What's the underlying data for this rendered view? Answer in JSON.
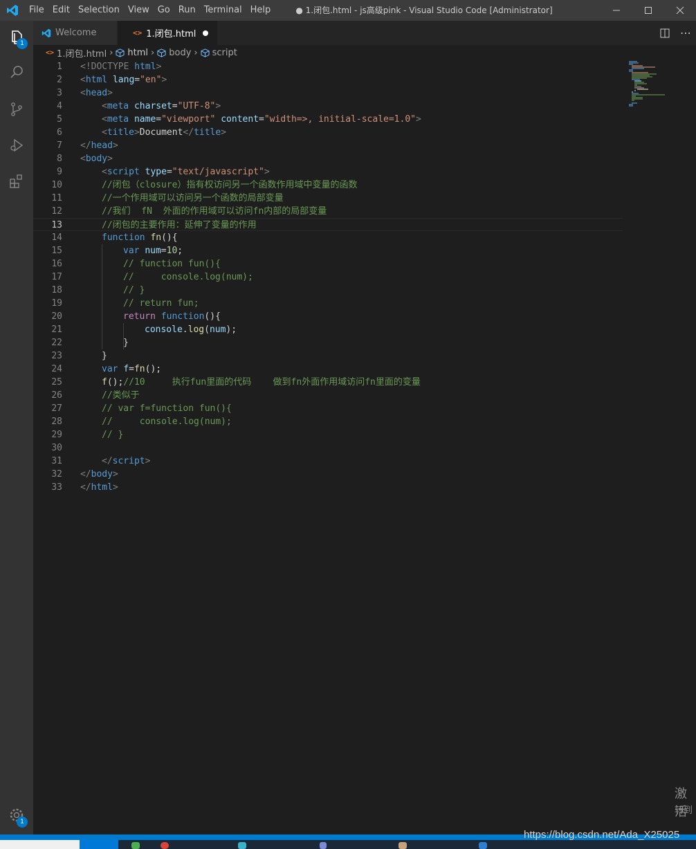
{
  "titlebar": {
    "menu": [
      "File",
      "Edit",
      "Selection",
      "View",
      "Go",
      "Run",
      "Terminal",
      "Help"
    ],
    "title": "● 1.闭包.html - js高级pink - Visual Studio Code [Administrator]"
  },
  "activitybar": {
    "explorer_badge": "1",
    "manage_badge": "1"
  },
  "tabs": [
    {
      "label": "Welcome"
    },
    {
      "label": "1.闭包.html"
    }
  ],
  "breadcrumb": [
    "1.闭包.html",
    "html",
    "body",
    "script"
  ],
  "editor": {
    "line_numbers": [
      "1",
      "2",
      "3",
      "4",
      "5",
      "6",
      "7",
      "8",
      "9",
      "10",
      "11",
      "12",
      "13",
      "14",
      "15",
      "16",
      "17",
      "18",
      "19",
      "20",
      "21",
      "22",
      "23",
      "24",
      "25",
      "26",
      "27",
      "28",
      "29",
      "30",
      "31",
      "32",
      "33"
    ],
    "l1": {
      "a": "<!DOCTYPE ",
      "b": "html",
      "c": ">"
    },
    "l2": {
      "a": "<",
      "b": "html",
      "c": " lang",
      "d": "=",
      "e": "\"en\"",
      "f": ">"
    },
    "l3": {
      "a": "<",
      "b": "head",
      "c": ">"
    },
    "l4": {
      "a": "<",
      "b": "meta",
      "c": " charset",
      "d": "=",
      "e": "\"UTF-8\"",
      "f": ">"
    },
    "l5": {
      "a": "<",
      "b": "meta",
      "c": " name",
      "d": "=",
      "e": "\"viewport\"",
      "f": " content",
      "g": "=",
      "h": "\"width=>, initial-scale=1.0\"",
      "i": ">"
    },
    "l6": {
      "a": "<",
      "b": "title",
      "c": ">",
      "d": "Document",
      "e": "</",
      "f": "title",
      "g": ">"
    },
    "l7": {
      "a": "</",
      "b": "head",
      "c": ">"
    },
    "l8": {
      "a": "<",
      "b": "body",
      "c": ">"
    },
    "l9": {
      "a": "<",
      "b": "script",
      "c": " type",
      "d": "=",
      "e": "\"text/javascript\"",
      "f": ">"
    },
    "l10": "//闭包（closure）指有权访问另一个函数作用域中变量的函数",
    "l11": "//一个作用域可以访问另一个函数的局部变量",
    "l12": "//我们  fN  外面的作用域可以访问fn内部的局部变量",
    "l13": "//闭包的主要作用：延伸了变量的作用",
    "l14": {
      "a": "function",
      "b": " ",
      "c": "fn",
      "d": "(){"
    },
    "l15": {
      "a": "var",
      "b": " ",
      "c": "num",
      "d": "=",
      "e": "10",
      "f": ";"
    },
    "l16": "// function fun(){",
    "l17": "//     console.log(num);",
    "l18": "// }",
    "l19": "// return fun;",
    "l20": {
      "a": "return",
      "b": " ",
      "c": "function",
      "d": "(){"
    },
    "l21": {
      "a": "console",
      "b": ".",
      "c": "log",
      "d": "(",
      "e": "num",
      "f": ");"
    },
    "l22": "}",
    "l23": "}",
    "l24": {
      "a": "var",
      "b": " ",
      "c": "f",
      "d": "=",
      "e": "fn",
      "f": "();"
    },
    "l25": {
      "a": "f",
      "b": "();",
      "c": "//10     执行fun里面的代码    做到fn外面作用域访问fn里面的变量"
    },
    "l26": "//类似于",
    "l27": "// var f=function fun(){",
    "l28": "//     console.log(num);",
    "l29": "// }",
    "l30": "",
    "l31": {
      "a": "</",
      "b": "script",
      "c": ">"
    },
    "l32": {
      "a": "</",
      "b": "body",
      "c": ">"
    },
    "l33": {
      "a": "</",
      "b": "html",
      "c": ">"
    }
  },
  "watermark": {
    "activate": "激活",
    "goto": "转到",
    "url": "https://blog.csdn.net/Ada_X25025"
  }
}
